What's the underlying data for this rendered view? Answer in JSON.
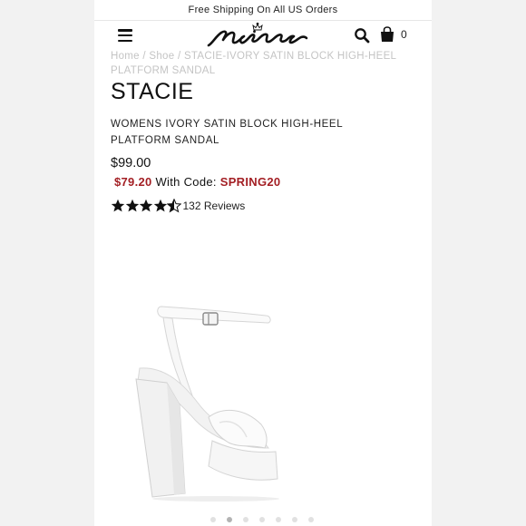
{
  "promo_bar": {
    "text": "Free Shipping On All US Orders"
  },
  "header": {
    "menu_icon": "hamburger-menu-icon",
    "logo_icon": "nina-logo",
    "search_icon": "search-icon",
    "cart_icon": "shopping-bag-icon",
    "cart_count": "0"
  },
  "breadcrumb": {
    "items": [
      "Home",
      "Shoe",
      "STACIE-IVORY SATIN BLOCK HIGH-HEEL PLATFORM SANDAL"
    ],
    "separator": "/"
  },
  "product": {
    "name": "STACIE",
    "description": "WOMENS IVORY SATIN BLOCK HIGH-HEEL PLATFORM SANDAL",
    "price": "$99.00",
    "sale_price": "$79.20",
    "code_label": "With Code:",
    "code": "SPRING20",
    "rating": 4.5,
    "review_count": "132 Reviews",
    "image_icon": "ivory-satin-platform-sandal-image"
  },
  "carousel": {
    "total_slides": 7,
    "active_slide": 2
  },
  "colors": {
    "sale_red": "#a31f24",
    "breadcrumb_gray": "#c4c4c4",
    "text_dark": "#111111"
  }
}
